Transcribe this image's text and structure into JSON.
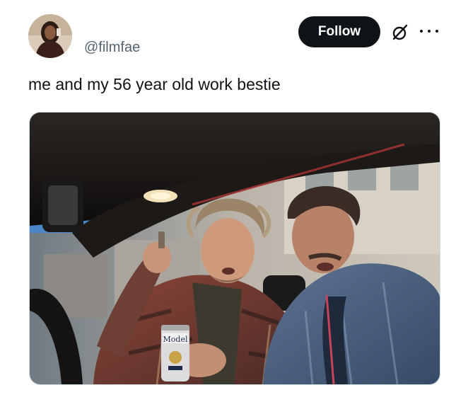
{
  "author": {
    "handle": "@filmfae",
    "avatar_icon": "user-avatar"
  },
  "actions": {
    "follow_label": "Follow",
    "grok_icon": "grok-icon",
    "more_icon": "more-icon"
  },
  "post": {
    "text": "me and my 56 year old work bestie",
    "media": {
      "kind": "photo",
      "can_label": "Model"
    }
  },
  "colors": {
    "text_primary": "#0f1419",
    "text_secondary": "#536471",
    "follow_bg": "#0f1419",
    "follow_text": "#ffffff",
    "border": "#cfd9de"
  }
}
